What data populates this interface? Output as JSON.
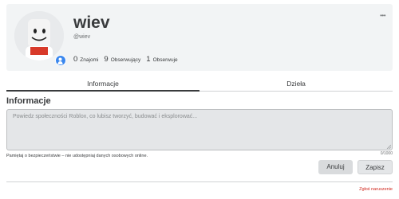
{
  "profile": {
    "display_name": "wiev",
    "username": "@wiev",
    "stats": [
      {
        "value": "0",
        "label": "Znajomi"
      },
      {
        "value": "9",
        "label": "Obserwujący"
      },
      {
        "value": "1",
        "label": "Obserwuje"
      }
    ],
    "more_label": "•••"
  },
  "tabs": [
    {
      "label": "Informacje",
      "active": true
    },
    {
      "label": "Dzieła",
      "active": false
    }
  ],
  "about": {
    "title": "Informacje",
    "placeholder": "Powiedz społeczności Roblox, co lubisz tworzyć, budować i eksplorować...",
    "counter": "0/1000",
    "disclaimer": "Pamiętaj o bezpieczeństwie – nie udostępniaj danych osobowych online."
  },
  "actions": {
    "cancel_label": "Anuluj",
    "save_label": "Zapisz"
  },
  "footer": {
    "report_label": "Zgłoś naruszenie"
  },
  "colors": {
    "accent": "#3a87ee",
    "report": "#d0251b",
    "card_bg": "#f2f4f5"
  },
  "icons": {
    "presence": "person-icon",
    "more": "more-icon"
  }
}
